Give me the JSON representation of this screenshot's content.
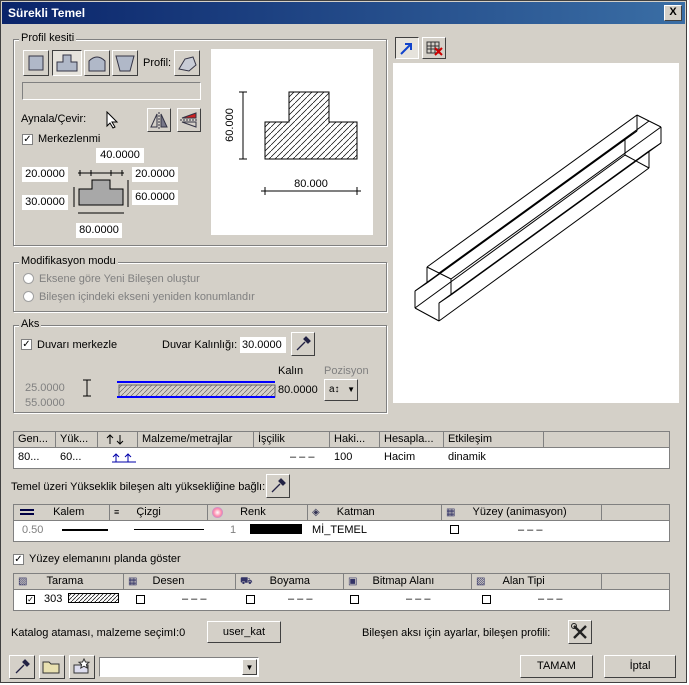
{
  "window": {
    "title": "Sürekli Temel",
    "close": "X"
  },
  "profile": {
    "group_label": "Profil kesiti",
    "profil_label": "Profil:",
    "mirror_label": "Aynala/Çevir:",
    "center_label": "Merkezlenmi",
    "center_checked": true,
    "dims": {
      "top": "40.0000",
      "left1": "20.0000",
      "right1": "20.0000",
      "left2": "30.0000",
      "right2": "60.0000",
      "bottom": "80.0000"
    },
    "preview": {
      "height": "60.000",
      "width": "80.000"
    }
  },
  "mod": {
    "group_label": "Modifikasyon modu",
    "opt1": "Eksene göre Yeni Bileşen oluştur",
    "opt2": "Bileşen içindeki ekseni yeniden konumlandır"
  },
  "axis": {
    "group_label": "Aks",
    "center_wall": "Duvarı merkezle",
    "center_checked": true,
    "thickness_label": "Duvar Kalınlığı:",
    "thickness_value": "30.0000",
    "v1": "25.0000",
    "v2": "55.0000",
    "kalin_label": "Kalın",
    "kalin_value": "80.0000",
    "pos_label": "Pozisyon"
  },
  "comp_table": {
    "headers": [
      "Gen...",
      "Yük...",
      "",
      "Malzeme/metrajlar",
      "İşçilik",
      "Haki...",
      "Hesapla...",
      "Etkileşim"
    ],
    "row": [
      "80...",
      "60...",
      "",
      "",
      "– – –",
      "100",
      "Hacim",
      "dinamik"
    ]
  },
  "height_link": "Temel üzeri Yükseklik bileşen altı yüksekliğine bağlı:",
  "pen_table": {
    "headers": [
      "Kalem",
      "Çizgi",
      "Renk",
      "Katman",
      "Yüzey (animasyon)"
    ],
    "row": {
      "pen": "0.50",
      "color_idx": "1",
      "layer": "Mİ_TEMEL",
      "surface": "– – –"
    }
  },
  "show_surface": {
    "label": "Yüzey elemanını planda göster",
    "checked": true
  },
  "hatch_table": {
    "headers": [
      "Tarama",
      "Desen",
      "Boyama",
      "Bitmap Alanı",
      "Alan Tipi"
    ],
    "row": {
      "hatch": "303",
      "desen": "– – –",
      "boyama": "– – –",
      "bitmap": "– – –",
      "alan": "– – –"
    }
  },
  "catalog": {
    "label": "Katalog ataması, malzeme seçimI:0",
    "button": "user_kat"
  },
  "axis_settings": "Bileşen aksı için ayarlar, bileşen profili:",
  "buttons": {
    "ok": "TAMAM",
    "cancel": "İptal"
  },
  "combo_value": ""
}
